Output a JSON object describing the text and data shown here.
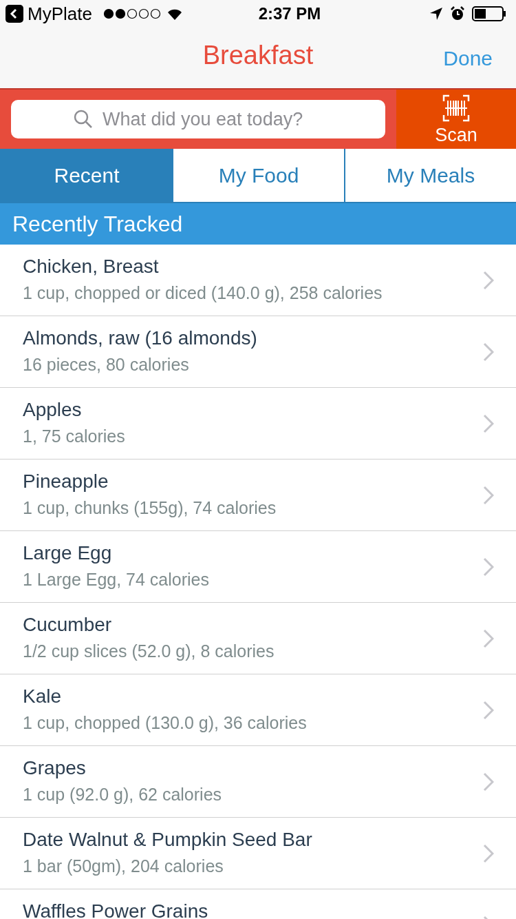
{
  "status_bar": {
    "back_app": "MyPlate",
    "time": "2:37 PM"
  },
  "nav": {
    "title": "Breakfast",
    "done": "Done"
  },
  "search": {
    "placeholder": "What did you eat today?",
    "scan": "Scan"
  },
  "tabs": [
    {
      "label": "Recent",
      "selected": true
    },
    {
      "label": "My Food",
      "selected": false
    },
    {
      "label": "My Meals",
      "selected": false
    }
  ],
  "section": "Recently Tracked",
  "foods": [
    {
      "name": "Chicken, Breast",
      "detail": "1 cup, chopped or diced (140.0 g), 258 calories"
    },
    {
      "name": "Almonds, raw (16 almonds)",
      "detail": "16 pieces, 80 calories"
    },
    {
      "name": "Apples",
      "detail": "1, 75 calories"
    },
    {
      "name": "Pineapple",
      "detail": "1 cup, chunks (155g), 74 calories"
    },
    {
      "name": "Large Egg",
      "detail": "1 Large Egg, 74 calories"
    },
    {
      "name": "Cucumber",
      "detail": "1/2 cup slices (52.0 g), 8 calories"
    },
    {
      "name": "Kale",
      "detail": "1 cup, chopped (130.0 g), 36 calories"
    },
    {
      "name": "Grapes",
      "detail": "1 cup (92.0 g), 62 calories"
    },
    {
      "name": "Date Walnut & Pumpkin Seed Bar",
      "detail": "1 bar (50gm), 204 calories"
    },
    {
      "name": "Waffles Power Grains"
    }
  ]
}
